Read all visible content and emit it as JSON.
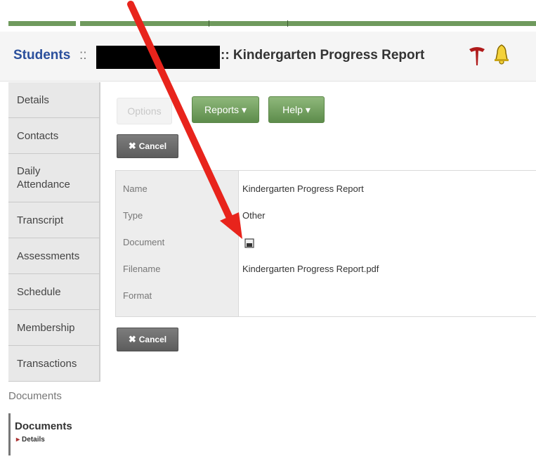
{
  "header": {
    "module": "Students",
    "separator": "::",
    "page_title": ":: Kindergarten Progress Report"
  },
  "sidebar": {
    "items": [
      {
        "label": "Details"
      },
      {
        "label": "Contacts"
      },
      {
        "label": "Daily Attendance"
      },
      {
        "label": "Transcript"
      },
      {
        "label": "Assessments"
      },
      {
        "label": "Schedule"
      },
      {
        "label": "Membership"
      },
      {
        "label": "Transactions"
      }
    ],
    "section_header": "Documents",
    "current": {
      "label": "Documents",
      "sub_label": "Details"
    }
  },
  "toolbar": {
    "options_label": "Options",
    "reports_label": "Reports ▾",
    "help_label": "Help ▾",
    "cancel_label": "Cancel"
  },
  "document": {
    "fields": [
      {
        "label": "Name",
        "value": "Kindergarten Progress Report"
      },
      {
        "label": "Type",
        "value": "Other"
      },
      {
        "label": "Document",
        "value": ""
      },
      {
        "label": "Filename",
        "value": "Kindergarten Progress Report.pdf"
      },
      {
        "label": "Format",
        "value": ""
      }
    ]
  },
  "colors": {
    "accent_green": "#6f9a5d",
    "link_blue": "#2a4f9c",
    "annotation_red": "#e8241c"
  },
  "icons": [
    "t-logo-icon",
    "bell-warning-icon",
    "document-icon",
    "close-icon",
    "chevron-down-icon"
  ]
}
